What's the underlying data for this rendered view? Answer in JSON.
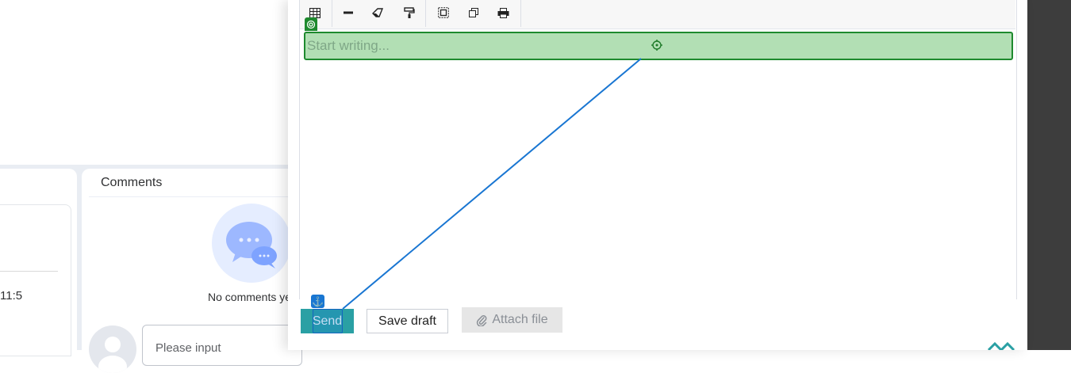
{
  "left_panel": {
    "time_fragment": "11:5"
  },
  "comments": {
    "title": "Comments",
    "empty_text": "No comments ye",
    "input_placeholder": "Please input"
  },
  "editor": {
    "placeholder": "Start writing...",
    "toolbar": [
      "table-icon",
      "horizontal-rule-icon",
      "eraser-icon",
      "format-painter-icon",
      "select-all-icon",
      "copy-icon",
      "print-icon"
    ]
  },
  "actions": {
    "send_label": "Send",
    "save_draft_label": "Save draft",
    "attach_label": "Attach file"
  },
  "colors": {
    "send": "#2aa0a4",
    "target_highlight": "#b2dfb4",
    "target_border": "#1e8a2e",
    "connector": "#1976d2"
  }
}
